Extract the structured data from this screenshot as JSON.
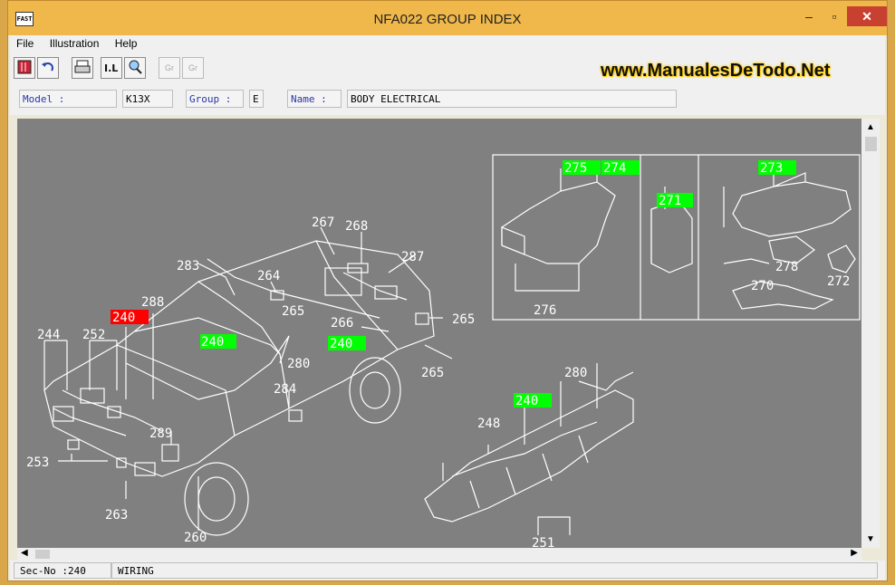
{
  "window": {
    "title": "NFA022 GROUP INDEX",
    "icon_text": "FAST"
  },
  "window_controls": {
    "minimize": "–",
    "maximize": "▫",
    "close": "✕"
  },
  "menu": [
    "File",
    "Illustration",
    "Help"
  ],
  "toolbar": {
    "icons": [
      "book-icon",
      "back-arrow-icon",
      "print-icon",
      "illustration-icon",
      "search-icon",
      "prev-group-icon",
      "next-group-icon"
    ],
    "prev_group_label": "Gr",
    "next_group_label": "Gr"
  },
  "watermark": "www.ManualesDeTodo.Net",
  "info": {
    "model_label": "Model :",
    "model_value": "K13X",
    "group_label": "Group :",
    "group_value": "E",
    "name_label": "Name :",
    "name_value": "BODY ELECTRICAL"
  },
  "diagram": {
    "labels": [
      "240",
      "240",
      "240",
      "240",
      "244",
      "248",
      "251",
      "252",
      "253",
      "260",
      "263",
      "264",
      "265",
      "265",
      "265",
      "266",
      "267",
      "268",
      "270",
      "271",
      "272",
      "273",
      "274",
      "275",
      "276",
      "278",
      "280",
      "280",
      "284",
      "287",
      "288",
      "289"
    ],
    "highlight_red": "240",
    "highlight_green": [
      "240",
      "275",
      "274",
      "271",
      "273"
    ],
    "colors": {
      "background": "#808080",
      "lines": "#ffffff",
      "red": "#ff0000",
      "green": "#00ff00"
    }
  },
  "status": {
    "sec_no": "Sec-No :240",
    "name": "WIRING"
  }
}
